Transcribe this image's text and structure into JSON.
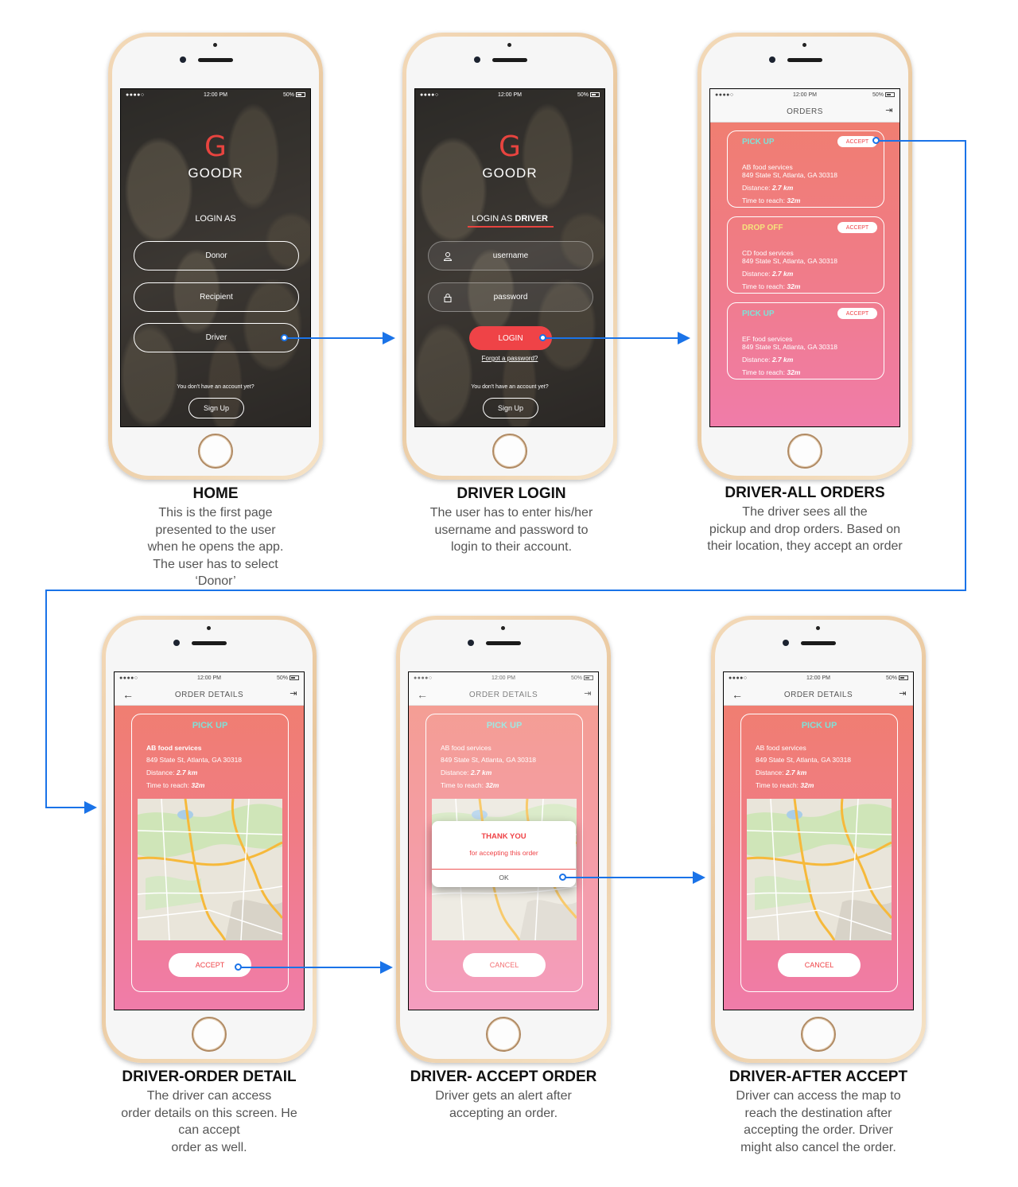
{
  "status_bar": {
    "carrier": "●●●●○",
    "time": "12:00 PM",
    "battery": "50%"
  },
  "app": {
    "logo_letter": "G",
    "logo_name": "GOODR"
  },
  "home": {
    "login_as": "LOGIN AS",
    "options": [
      "Donor",
      "Recipient",
      "Driver"
    ],
    "no_account": "You don't have an account yet?",
    "signup": "Sign Up",
    "caption_title": "HOME",
    "caption_lines": [
      "This is the first page",
      "presented to the user",
      "when he opens the app.",
      "The user has to select",
      "‘Donor’"
    ]
  },
  "driver_login": {
    "login_as_prefix": "LOGIN AS",
    "login_as_role": "DRIVER",
    "username_placeholder": "username",
    "password_placeholder": "password",
    "login": "LOGIN",
    "forgot": "Forgot a password?",
    "no_account": "You don't have an account yet?",
    "signup": "Sign Up",
    "caption_title": "DRIVER LOGIN",
    "caption_lines": [
      "The user has to enter his/her",
      "username and password to",
      "login to their account."
    ]
  },
  "all_orders": {
    "title": "ORDERS",
    "orders": [
      {
        "type": "PICK UP",
        "accept": "ACCEPT",
        "name": "AB food services",
        "address": "849 State St, Atlanta, GA 30318",
        "distance_label": "Distance:",
        "distance": "2.7 km",
        "time_label": "Time to reach:",
        "time": "32m"
      },
      {
        "type": "DROP OFF",
        "accept": "ACCEPT",
        "name": "CD food services",
        "address": "849 State St, Atlanta, GA 30318",
        "distance_label": "Distance:",
        "distance": "2.7 km",
        "time_label": "Time to reach:",
        "time": "32m"
      },
      {
        "type": "PICK UP",
        "accept": "ACCEPT",
        "name": "EF food services",
        "address": "849 State St, Atlanta, GA 30318",
        "distance_label": "Distance:",
        "distance": "2.7 km",
        "time_label": "Time to reach:",
        "time": "32m"
      }
    ],
    "caption_title": "DRIVER-ALL ORDERS",
    "caption_lines": [
      "The driver sees all the",
      "pickup and drop orders. Based on",
      "their location, they accept an order"
    ]
  },
  "order_detail": {
    "title": "ORDER DETAILS",
    "type": "PICK UP",
    "name": "AB food services",
    "address": "849 State St, Atlanta, GA 30318",
    "distance_label": "Distance:",
    "distance": "2.7 km",
    "time_label": "Time to reach:",
    "time": "32m",
    "accept": "ACCEPT",
    "cancel": "CANCEL"
  },
  "screens": {
    "detail": {
      "caption_title": "DRIVER-ORDER DETAIL",
      "caption_lines": [
        "The driver can access",
        "order details on this screen. He",
        "can accept",
        "order as well."
      ]
    },
    "accept": {
      "caption_title": "DRIVER- ACCEPT ORDER",
      "caption_lines": [
        "Driver gets an alert after",
        "accepting an order."
      ],
      "alert_title": "THANK YOU",
      "alert_message": "for accepting this order",
      "alert_ok": "OK"
    },
    "after": {
      "caption_title": "DRIVER-AFTER ACCEPT",
      "caption_lines": [
        "Driver can access the map to",
        "reach the destination after",
        "accepting the order. Driver",
        "might also cancel the order."
      ]
    }
  },
  "colors": {
    "accent_red": "#ef4347",
    "flow_arrow": "#1a73e8",
    "pickup_label": "#7fe1d8",
    "dropoff_label": "#f5e37d",
    "gradient_top": "#f07e6c",
    "gradient_bottom": "#f07ca9"
  },
  "icons": {
    "wifi": "wifi-icon",
    "battery": "battery-icon",
    "user": "user-icon",
    "lock": "lock-icon",
    "back": "back-arrow-icon",
    "logout": "logout-icon"
  }
}
